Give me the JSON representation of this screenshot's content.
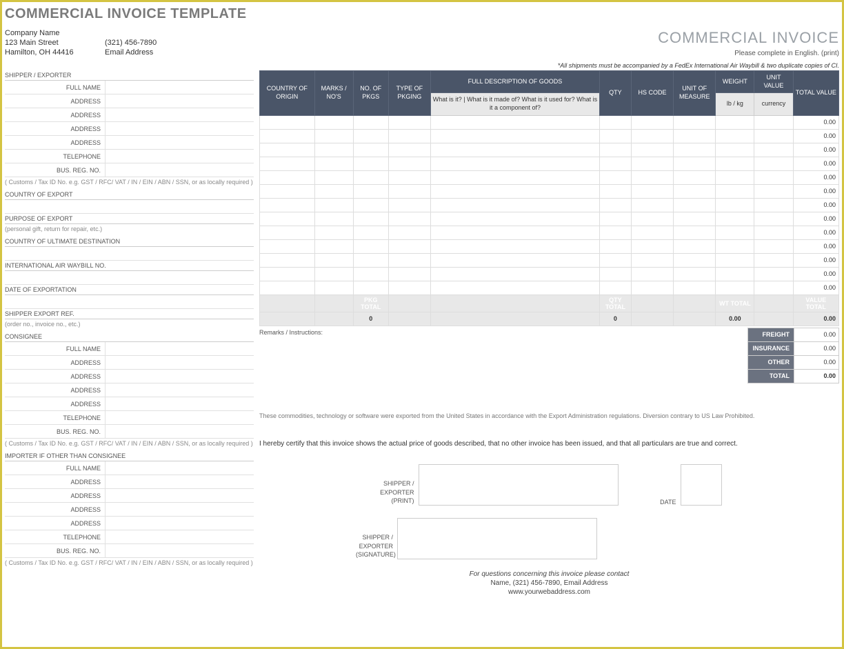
{
  "title": "COMMERCIAL INVOICE TEMPLATE",
  "company": {
    "name": "Company Name",
    "street": "123 Main Street",
    "phone": "(321) 456-7890",
    "citystate": "Hamilton, OH  44416",
    "email": "Email Address"
  },
  "invoice_title": "COMMERCIAL INVOICE",
  "please_complete": "Please complete in English. (print)",
  "shipment_note": "*All shipments must be accompanied by a FedEx International Air Waybill & two duplicate copies of CI.",
  "shipper_section": "SHIPPER / EXPORTER",
  "consignee_section": "CONSIGNEE",
  "importer_section": "IMPORTER IF OTHER THAN CONSIGNEE",
  "fields": {
    "full_name": "FULL NAME",
    "address": "ADDRESS",
    "telephone": "TELEPHONE",
    "bus_reg": "BUS. REG. NO."
  },
  "customs_note": "( Customs / Tax ID No. e.g. GST / RFC/ VAT / IN / EIN / ABN / SSN, or as locally required )",
  "country_export": "COUNTRY OF EXPORT",
  "purpose_export": "PURPOSE OF EXPORT",
  "purpose_hint": "(personal gift, return for repair, etc.)",
  "country_ult": "COUNTRY OF ULTIMATE DESTINATION",
  "air_waybill": "INTERNATIONAL AIR WAYBILL NO.",
  "date_export": "DATE OF EXPORTATION",
  "shipper_ref": "SHIPPER EXPORT REF.",
  "ref_hint": "(order no., invoice no., etc.)",
  "table_headers": {
    "country_origin": "COUNTRY OF ORIGIN",
    "marks": "MARKS / NO'S",
    "no_pkgs": "NO. OF PKGS",
    "type_pkg": "TYPE OF PKGING",
    "full_desc": "FULL DESCRIPTION OF GOODS",
    "desc_hint": "What is it? | What is it made of? What is it used for? What is it a component of?",
    "qty": "QTY",
    "hs_code": "HS CODE",
    "unit_measure": "UNIT OF MEASURE",
    "weight": "WEIGHT",
    "weight_sub": "lb / kg",
    "unit_value": "UNIT VALUE",
    "value_sub": "currency",
    "total_value": "TOTAL VALUE"
  },
  "row_totals": [
    "0.00",
    "0.00",
    "0.00",
    "0.00",
    "0.00",
    "0.00",
    "0.00",
    "0.00",
    "0.00",
    "0.00",
    "0.00",
    "0.00",
    "0.00"
  ],
  "totals_labels": {
    "pkg_total": "PKG TOTAL",
    "qty_total": "QTY TOTAL",
    "wt_total": "WT TOTAL",
    "value_total": "VALUE TOTAL",
    "pkg_val": "0",
    "qty_val": "0",
    "wt_val": "0.00",
    "value_val": "0.00"
  },
  "remarks_label": "Remarks / Instructions:",
  "summary": {
    "freight": "FREIGHT",
    "insurance": "INSURANCE",
    "other": "OTHER",
    "total": "TOTAL",
    "freight_val": "0.00",
    "insurance_val": "0.00",
    "other_val": "0.00",
    "total_val": "0.00"
  },
  "export_statement": "These commodities, technology or software were exported from the United States in accordance with the Export Administration regulations.  Diversion contrary to US Law Prohibited.",
  "certify": "I hereby certify that this invoice shows the actual price of goods described, that no other invoice has been issued, and that all particulars are true and correct.",
  "sig": {
    "print": "SHIPPER / EXPORTER (PRINT)",
    "signature": "SHIPPER / EXPORTER (SIGNATURE)",
    "date": "DATE"
  },
  "footer": {
    "contact": "For questions concerning this invoice please contact",
    "info": "Name, (321) 456-7890, Email Address",
    "web": "www.yourwebaddress.com"
  }
}
